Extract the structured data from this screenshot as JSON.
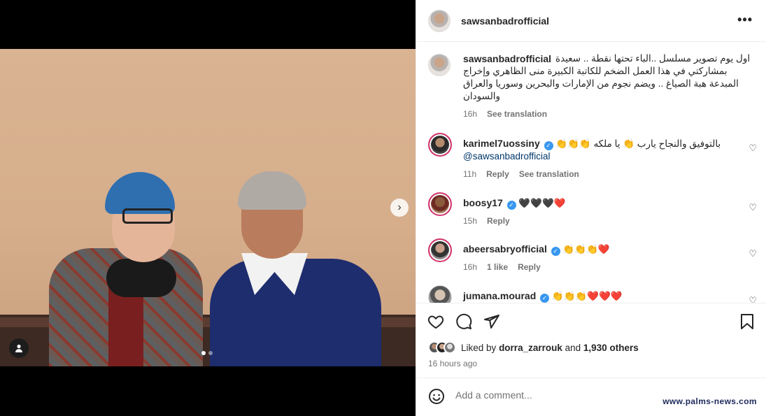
{
  "post": {
    "username": "sawsanbadrofficial",
    "more_icon": "more-horizontal-icon",
    "caption": {
      "username": "sawsanbadrofficial",
      "text": "اول يوم تصوير مسلسل ..الباء تحتها نقطة .. سعيدة بمشاركتي في هذا العمل الضخم للكاتبة الكبيرة منى الظاهري وإخراج المبدعة هبة الصياغ .. ويضم نجوم من الإمارات والبحرين وسوريا والعراق والسودان",
      "time": "16h",
      "see_translation": "See translation"
    },
    "comments": [
      {
        "username": "karimel7uossiny",
        "verified": true,
        "text": "بالتوفيق والنجاح يارب 👏 يا ملكه 👏👏👏",
        "mention": "@sawsanbadrofficial",
        "time": "11h",
        "reply": "Reply",
        "see_translation": "See translation"
      },
      {
        "username": "boosy17",
        "verified": true,
        "text": "🖤🖤🖤❤️",
        "time": "15h",
        "reply": "Reply"
      },
      {
        "username": "abeersabryofficial",
        "verified": true,
        "text": "👏👏👏❤️",
        "time": "16h",
        "likes": "1 like",
        "reply": "Reply"
      },
      {
        "username": "jumana.mourad",
        "verified": true,
        "text": "👏👏👏❤️❤️❤️"
      }
    ],
    "actions": {
      "like_icon": "heart-icon",
      "comment_icon": "comment-icon",
      "share_icon": "share-icon",
      "save_icon": "bookmark-icon"
    },
    "likes": {
      "prefix": "Liked by",
      "user": "dorra_zarrouk",
      "middle": "and",
      "count": "1,930 others"
    },
    "time_ago": "16 hours ago",
    "add_comment_placeholder": "Add a comment...",
    "emoji_icon": "smiley-icon"
  },
  "media": {
    "next_icon": "chevron-right-icon",
    "tag_icon": "user-tag-icon",
    "carousel_index": 1,
    "carousel_total": 2
  },
  "watermark": "www.palms-news.com"
}
